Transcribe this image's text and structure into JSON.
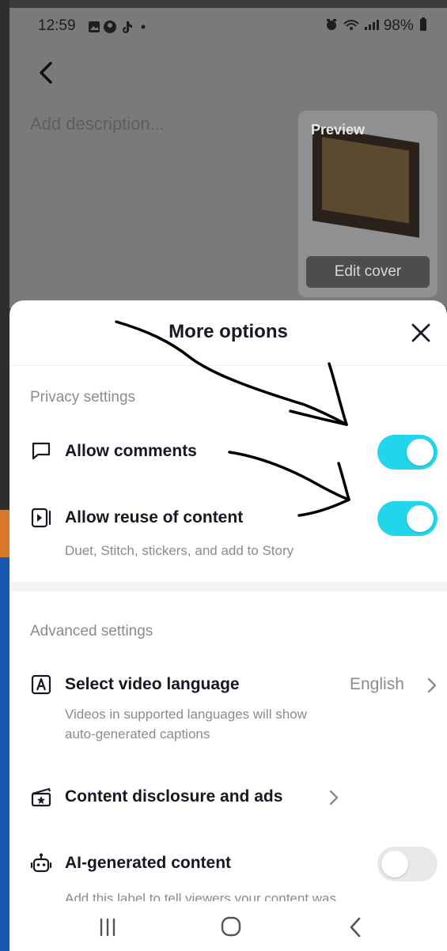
{
  "status_bar": {
    "time": "12:59",
    "battery": "98%",
    "icons": [
      "gallery-icon",
      "face-icon",
      "tiktok-icon",
      "dot-icon",
      "alarm-icon",
      "wifi-icon",
      "signal-icon",
      "battery-icon"
    ]
  },
  "top": {
    "description_placeholder": "Add description...",
    "preview_label": "Preview",
    "edit_cover_label": "Edit cover"
  },
  "sheet": {
    "title": "More options",
    "privacy_section": "Privacy settings",
    "allow_comments": {
      "label": "Allow comments",
      "enabled": true
    },
    "allow_reuse": {
      "label": "Allow reuse of content",
      "sub": "Duet, Stitch, stickers, and add to Story",
      "enabled": true
    },
    "advanced_section": "Advanced settings",
    "video_language": {
      "label": "Select video language",
      "value": "English",
      "sub_line1": "Videos in supported languages will show",
      "sub_line2": "auto-generated captions"
    },
    "disclosure": {
      "label": "Content disclosure and ads"
    },
    "ai_content": {
      "label": "AI-generated content",
      "sub": "Add this label to tell viewers your content was",
      "enabled": false
    }
  },
  "colors": {
    "toggle_on": "#20d5ec",
    "toggle_off": "#e8e8ea",
    "text_primary": "#161823",
    "text_secondary": "#8a8b91"
  },
  "navbar": {
    "icons": [
      "recents-icon",
      "home-icon",
      "back-icon"
    ]
  }
}
